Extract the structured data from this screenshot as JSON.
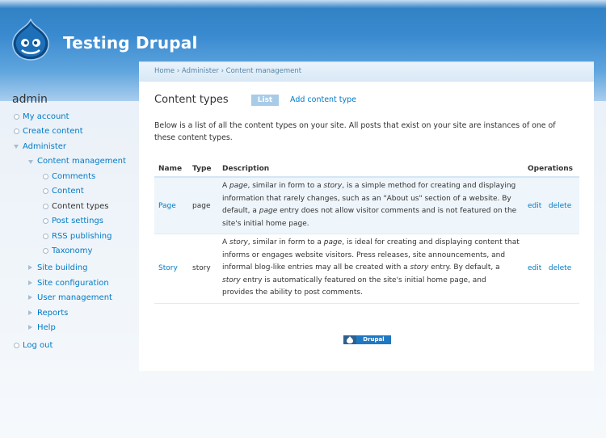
{
  "header": {
    "site_name": "Testing Drupal"
  },
  "sidebar": {
    "title": "admin",
    "items": [
      {
        "label": "My account"
      },
      {
        "label": "Create content"
      },
      {
        "label": "Administer"
      },
      {
        "label": "Content management"
      },
      {
        "label": "Comments"
      },
      {
        "label": "Content"
      },
      {
        "label": "Content types"
      },
      {
        "label": "Post settings"
      },
      {
        "label": "RSS publishing"
      },
      {
        "label": "Taxonomy"
      },
      {
        "label": "Site building"
      },
      {
        "label": "Site configuration"
      },
      {
        "label": "User management"
      },
      {
        "label": "Reports"
      },
      {
        "label": "Help"
      },
      {
        "label": "Log out"
      }
    ]
  },
  "breadcrumb": {
    "home": "Home",
    "sep": "›",
    "administer": "Administer",
    "content_management": "Content management"
  },
  "main": {
    "title": "Content types",
    "tabs": {
      "list": "List",
      "add": "Add content type"
    },
    "intro": "Below is a list of all the content types on your site. All posts that exist on your site are instances of one of these content types."
  },
  "table": {
    "headers": {
      "name": "Name",
      "type": "Type",
      "description": "Description",
      "operations": "Operations"
    },
    "rows": [
      {
        "name": "Page",
        "type": "page",
        "desc_parts": [
          "A ",
          "page",
          ", similar in form to a ",
          "story",
          ", is a simple method for creating and displaying information that rarely changes, such as an \"About us\" section of a website. By default, a ",
          "page",
          " entry does not allow visitor comments and is not featured on the site's initial home page."
        ],
        "edit": "edit",
        "delete": "delete"
      },
      {
        "name": "Story",
        "type": "story",
        "desc_parts": [
          "A ",
          "story",
          ", similar in form to a ",
          "page",
          ", is ideal for creating and displaying content that informs or engages website visitors. Press releases, site announcements, and informal blog-like entries may all be created with a ",
          "story",
          " entry. By default, a ",
          "story",
          " entry is automatically featured on the site's initial home page, and provides the ability to post comments."
        ],
        "edit": "edit",
        "delete": "delete"
      }
    ]
  },
  "footer": {
    "badge_text": "Drupal"
  },
  "colors": {
    "link": "#027ac6",
    "header_blue": "#3a8ad0",
    "tab_active": "#a8cbe8"
  }
}
